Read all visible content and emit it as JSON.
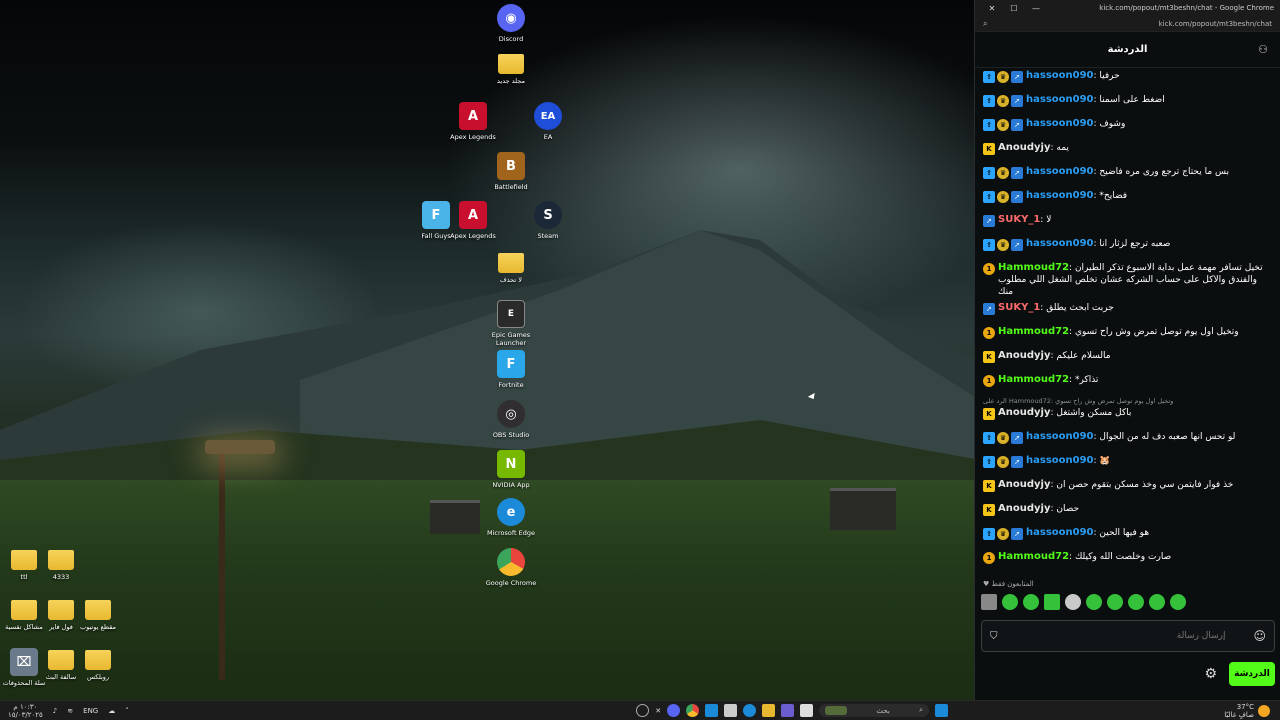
{
  "chrome": {
    "title": "kick.com/popout/mt3beshn/chat - Google Chrome",
    "url": "kick.com/popout/mt3beshn/chat",
    "close_glyph": "✕",
    "max_glyph": "☐",
    "min_glyph": "—"
  },
  "chat": {
    "title": "الدردشة",
    "messages": [
      {
        "badges": [
          "sub",
          "cup",
          "arrow"
        ],
        "user": "hassoon090",
        "color": "#2a9df4",
        "text": "حرفيا"
      },
      {
        "badges": [
          "sub",
          "cup",
          "arrow"
        ],
        "user": "hassoon090",
        "color": "#2a9df4",
        "text": "اضغط على اسمنا"
      },
      {
        "badges": [
          "sub",
          "cup",
          "arrow"
        ],
        "user": "hassoon090",
        "color": "#2a9df4",
        "text": "وشوف"
      },
      {
        "badges": [
          "k"
        ],
        "user": "Anoudyjy",
        "color": "#e6e6e6",
        "text": "يمه"
      },
      {
        "badges": [
          "sub",
          "cup",
          "arrow"
        ],
        "user": "hassoon090",
        "color": "#2a9df4",
        "text": "بس ما يحتاج ترجع ورى مره فاضيح"
      },
      {
        "badges": [
          "sub",
          "cup",
          "arrow"
        ],
        "user": "hassoon090",
        "color": "#2a9df4",
        "text": "فضايح*"
      },
      {
        "badges": [
          "arrow"
        ],
        "user": "SUKY_1",
        "color": "#ff6b6b",
        "text": "لا"
      },
      {
        "badges": [
          "sub",
          "cup",
          "arrow"
        ],
        "user": "hassoon090",
        "color": "#2a9df4",
        "text": "صعبه ترجع لزثار انا"
      },
      {
        "badges": [
          "coin"
        ],
        "user": "Hammoud72",
        "color": "#53fc18",
        "text": "تخيل تسافر مهمة عمل بداية الاسبوع تذكر الطيران والفندق والاكل على حساب الشركه عشان تخلص الشغل اللي مطلوب منك"
      },
      {
        "badges": [
          "arrow"
        ],
        "user": "SUKY_1",
        "color": "#ff6b6b",
        "text": "جربت ابحث يطلق"
      },
      {
        "badges": [
          "coin"
        ],
        "user": "Hammoud72",
        "color": "#53fc18",
        "text": "وتخيل اول يوم توصل تمرض وش راح تسوي"
      },
      {
        "badges": [
          "k"
        ],
        "user": "Anoudyjy",
        "color": "#e6e6e6",
        "text": "مالسلام عليكم"
      },
      {
        "badges": [
          "coin"
        ],
        "user": "Hammoud72",
        "color": "#53fc18",
        "text": "تذاكر*"
      },
      {
        "badges": [
          "k"
        ],
        "user": "Anoudyjy",
        "color": "#e6e6e6",
        "text": "باكل مسكن واشتغل",
        "reply": "الرد على Hammoud72: وتخيل اول يوم توصل تمرض وش راح تسوي"
      },
      {
        "badges": [
          "sub",
          "cup",
          "arrow"
        ],
        "user": "hassoon090",
        "color": "#2a9df4",
        "text": "لو تحس انها صعبه دف له من الجوال"
      },
      {
        "badges": [
          "sub",
          "cup",
          "arrow"
        ],
        "user": "hassoon090",
        "color": "#2a9df4",
        "text": "🐹"
      },
      {
        "badges": [
          "k"
        ],
        "user": "Anoudyjy",
        "color": "#e6e6e6",
        "text": "خذ فوار فايتمن سي وخذ مسكن بتقوم حصن ان"
      },
      {
        "badges": [
          "k"
        ],
        "user": "Anoudyjy",
        "color": "#e6e6e6",
        "text": "حصان"
      },
      {
        "badges": [
          "sub",
          "cup",
          "arrow"
        ],
        "user": "hassoon090",
        "color": "#2a9df4",
        "text": "هو فيها الحين"
      },
      {
        "badges": [
          "coin"
        ],
        "user": "Hammoud72",
        "color": "#53fc18",
        "text": "صارت وخلصت الله وكيلك"
      }
    ],
    "followers_only": "المتابعون فقط",
    "input_placeholder": "إرسال رسالة",
    "send_label": "الدردشة"
  },
  "desktop_icons": [
    {
      "label": "Discord",
      "color": "#5865f2",
      "glyph": "◉"
    },
    {
      "label": "مجلد جديد",
      "color": "folder",
      "glyph": ""
    },
    {
      "label": "Apex Legends",
      "color": "#c8102e",
      "glyph": "A"
    },
    {
      "label": "EA",
      "color": "#1f4fd8",
      "glyph": "EA"
    },
    {
      "label": "Battlefield",
      "color": "#a0641c",
      "glyph": "B"
    },
    {
      "label": "Fall Guys",
      "color": "#4ab4e8",
      "glyph": "F"
    },
    {
      "label": "Apex Legends",
      "color": "#c8102e",
      "glyph": "A"
    },
    {
      "label": "Steam",
      "color": "#1b2838",
      "glyph": "S"
    },
    {
      "label": "لا تحذف",
      "color": "folder",
      "glyph": ""
    },
    {
      "label": "Epic Games Launcher",
      "color": "#2a2a2a",
      "glyph": "E"
    },
    {
      "label": "Fortnite",
      "color": "#2aa7e8",
      "glyph": "F"
    },
    {
      "label": "OBS Studio",
      "color": "#302e31",
      "glyph": "◎"
    },
    {
      "label": "NVIDIA App",
      "color": "#76b900",
      "glyph": "N"
    },
    {
      "label": "Microsoft Edge",
      "color": "#1b8ad8",
      "glyph": "e"
    },
    {
      "label": "Google Chrome",
      "color": "#e8453c",
      "glyph": "●"
    },
    {
      "label": "ttl",
      "color": "folder",
      "glyph": ""
    },
    {
      "label": "4333",
      "color": "folder",
      "glyph": ""
    },
    {
      "label": "مشاكل تقسية",
      "color": "folder",
      "glyph": ""
    },
    {
      "label": "فول فاير",
      "color": "folder",
      "glyph": ""
    },
    {
      "label": "مقطع يوتيوب",
      "color": "folder",
      "glyph": ""
    },
    {
      "label": "سلة المحذوفات",
      "color": "#6a7a8a",
      "glyph": "🗑"
    },
    {
      "label": "سالفة البث",
      "color": "folder",
      "glyph": ""
    },
    {
      "label": "روبلكس",
      "color": "folder",
      "glyph": ""
    }
  ],
  "taskbar": {
    "time": "١٠:٣٠ م",
    "date": "١٥/٠٣/٢٠٢٥",
    "lang": "ENG",
    "search_placeholder": "بحث",
    "weather": "37°C",
    "weather_label": "صافٍ غالبًا"
  }
}
